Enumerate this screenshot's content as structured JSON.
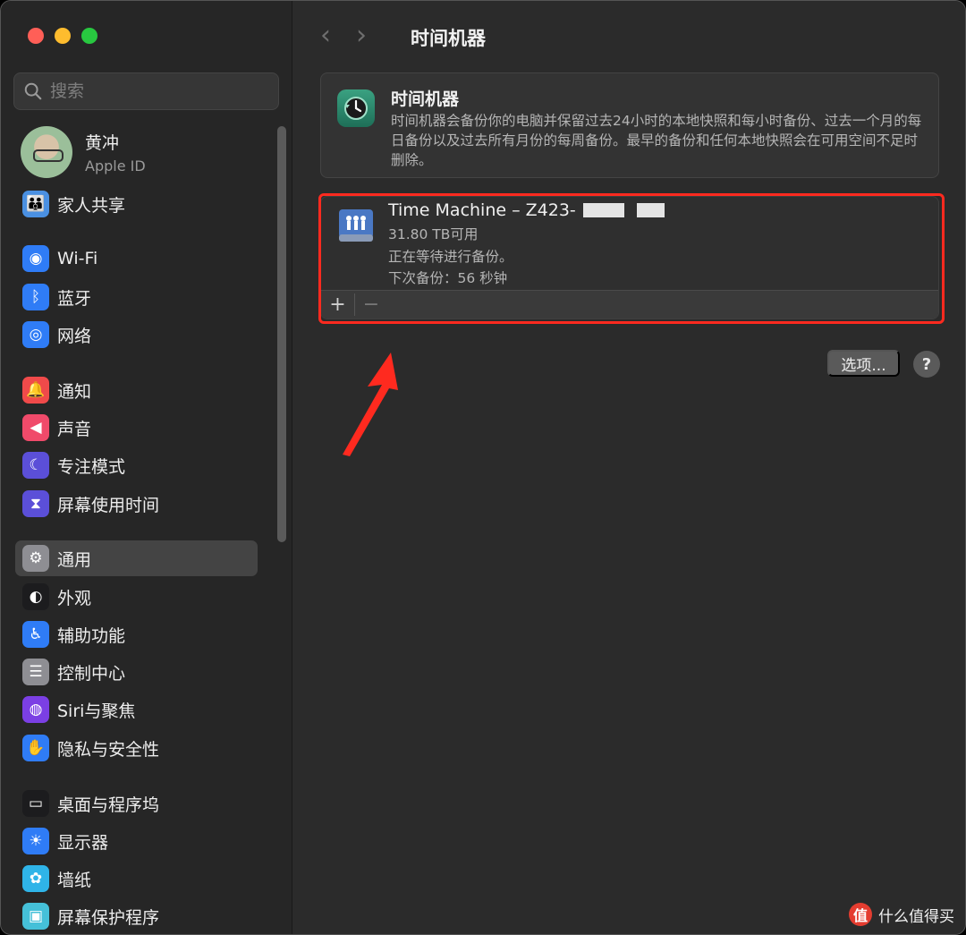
{
  "sidebar": {
    "search_placeholder": "搜索",
    "profile": {
      "name": "黄冲",
      "subtitle": "Apple ID"
    },
    "items": [
      {
        "label": "家人共享",
        "icon": "family-icon",
        "color": "#4a90e2"
      },
      {
        "label": "Wi-Fi",
        "icon": "wifi-icon",
        "color": "#2f7cf6"
      },
      {
        "label": "蓝牙",
        "icon": "bluetooth-icon",
        "color": "#2f7cf6"
      },
      {
        "label": "网络",
        "icon": "globe-icon",
        "color": "#2f7cf6"
      },
      {
        "label": "通知",
        "icon": "bell-icon",
        "color": "#f04a4a"
      },
      {
        "label": "声音",
        "icon": "speaker-icon",
        "color": "#f04a6a"
      },
      {
        "label": "专注模式",
        "icon": "moon-icon",
        "color": "#5b4fd8"
      },
      {
        "label": "屏幕使用时间",
        "icon": "hourglass-icon",
        "color": "#5b4fd8"
      },
      {
        "label": "通用",
        "icon": "gear-icon",
        "color": "#8e8e93"
      },
      {
        "label": "外观",
        "icon": "appearance-icon",
        "color": "#1c1c1e"
      },
      {
        "label": "辅助功能",
        "icon": "accessibility-icon",
        "color": "#2f7cf6"
      },
      {
        "label": "控制中心",
        "icon": "toggles-icon",
        "color": "#8e8e93"
      },
      {
        "label": "Siri与聚焦",
        "icon": "siri-icon",
        "color": "#7b3fe4"
      },
      {
        "label": "隐私与安全性",
        "icon": "hand-icon",
        "color": "#2f7cf6"
      },
      {
        "label": "桌面与程序坞",
        "icon": "dock-icon",
        "color": "#1c1c1e"
      },
      {
        "label": "显示器",
        "icon": "sun-icon",
        "color": "#2f7cf6"
      },
      {
        "label": "墙纸",
        "icon": "flower-icon",
        "color": "#2fb4e8"
      },
      {
        "label": "屏幕保护程序",
        "icon": "screensaver-icon",
        "color": "#45c0d8"
      }
    ],
    "selected": "通用"
  },
  "main": {
    "title": "时间机器",
    "info": {
      "title": "时间机器",
      "desc": "时间机器会备份你的电脑并保留过去24小时的本地快照和每小时备份、过去一个月的每日备份以及过去所有月份的每周备份。最早的备份和任何本地快照会在可用空间不足时删除。"
    },
    "disk": {
      "name": "Time Machine – Z423-",
      "available": "31.80 TB可用",
      "status": "正在等待进行备份。",
      "next": "下次备份：56 秒钟",
      "add_label": "+",
      "remove_label": "−"
    },
    "options_label": "选项...",
    "help_label": "?"
  },
  "watermark": {
    "badge": "值",
    "text": "什么值得买"
  },
  "colors": {
    "highlight": "#ff2a1f",
    "accent": "#2f7cf6"
  }
}
